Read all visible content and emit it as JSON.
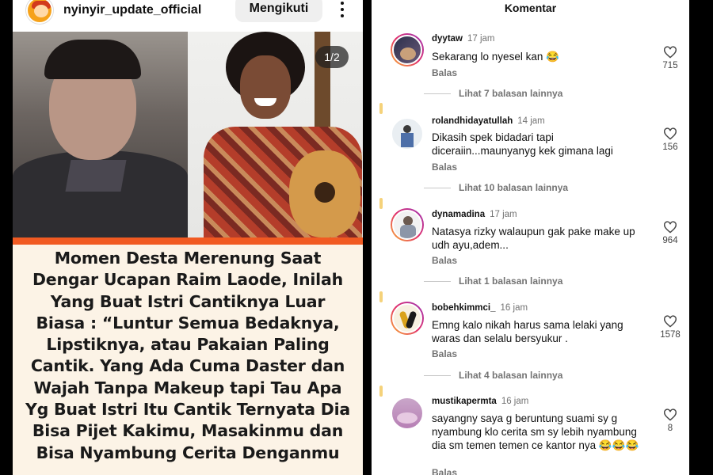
{
  "post": {
    "username": "nyinyir_update_official",
    "follow_label": "Mengikuti",
    "page_indicator": "1/2",
    "headline": "Momen Desta Merenung Saat Dengar Ucapan Raim Laode, Inilah Yang Buat Istri Cantiknya Luar Biasa : “Luntur Semua Bedaknya, Lipstiknya, atau Pakaian Paling Cantik. Yang Ada Cuma Daster dan Wajah Tanpa Makeup tapi Tau Apa Yg Buat Istri Itu Cantik Ternyata Dia Bisa Pijet Kakimu, Masakinmu dan Bisa Nyambung Cerita Denganmu",
    "accent_color": "#f15a22"
  },
  "comments_panel": {
    "title": "Komentar",
    "comments": [
      {
        "user": "dyytaw",
        "time": "17 jam",
        "text": "Sekarang lo nyesel kan 😂",
        "reply": "Balas",
        "likes": "715",
        "view_replies": "Lihat 7 balasan lainnya"
      },
      {
        "user": "rolandhidayatullah",
        "time": "14 jam",
        "text": "Dikasih spek bidadari tapi diceraiin...maunyanyg kek gimana lagi",
        "reply": "Balas",
        "likes": "156",
        "view_replies": "Lihat 10 balasan lainnya"
      },
      {
        "user": "dynamadina",
        "time": "17 jam",
        "text": "Natasya rizky walaupun gak pake make up udh ayu,adem...",
        "reply": "Balas",
        "likes": "964",
        "view_replies": "Lihat 1 balasan lainnya"
      },
      {
        "user": "bobehkimmci_",
        "time": "16 jam",
        "text": "Emng kalo nikah harus sama lelaki yang waras dan selalu bersyukur .",
        "reply": "Balas",
        "likes": "1578",
        "view_replies": "Lihat 4 balasan lainnya"
      },
      {
        "user": "mustikapermta",
        "time": "16 jam",
        "text": "sayangny saya g beruntung suami sy g nyambung klo cerita sm sy lebih nyambung dia sm temen temen ce kantor nya 😂😂😂",
        "reply": "Balas",
        "likes": "8",
        "view_replies": ""
      }
    ]
  }
}
